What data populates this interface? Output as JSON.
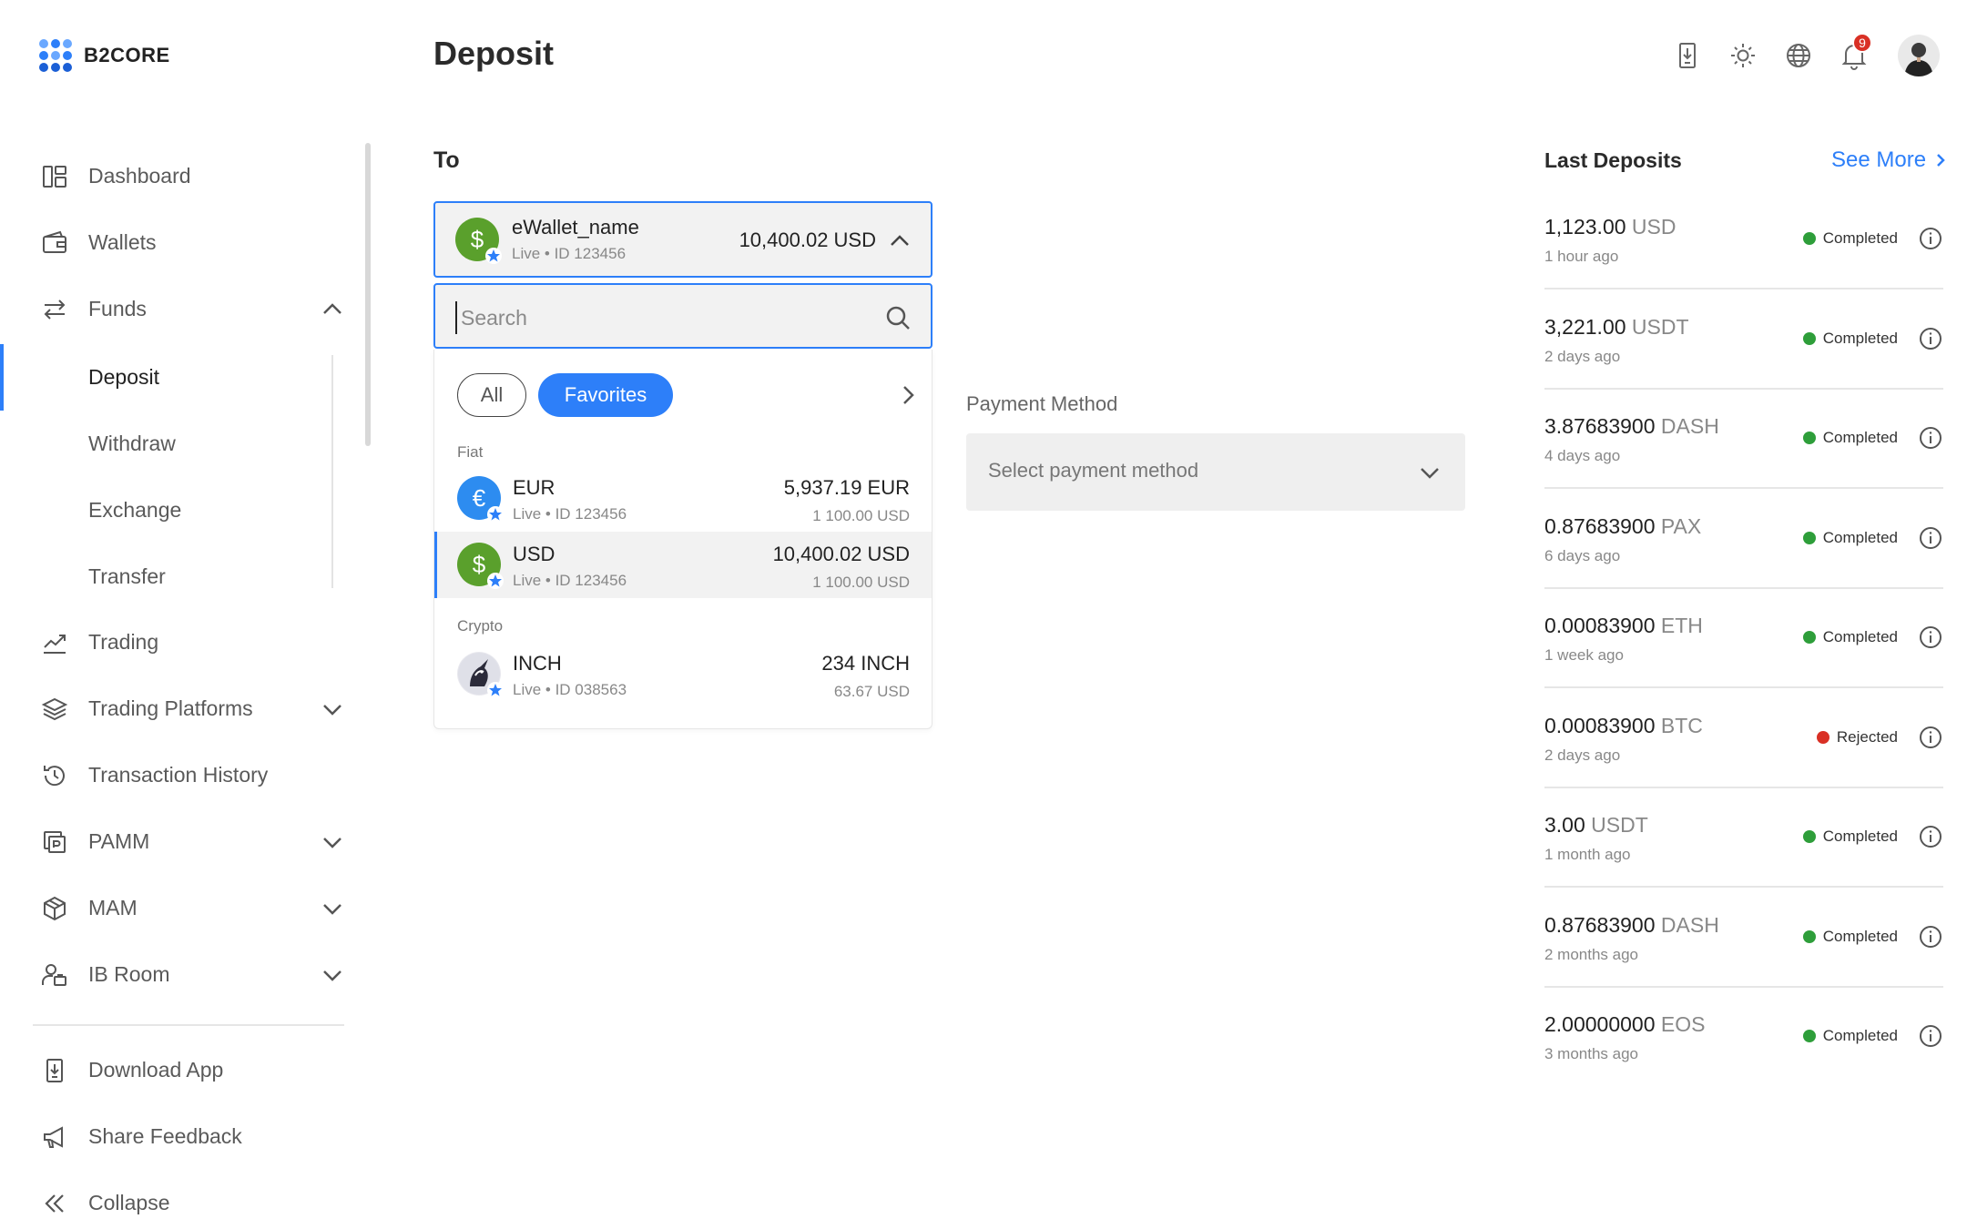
{
  "app": {
    "logo_text": "B2CORE"
  },
  "header": {
    "title": "Deposit",
    "notification_count": "9"
  },
  "sidebar": {
    "items": [
      {
        "label": "Dashboard",
        "icon": "dashboard-icon"
      },
      {
        "label": "Wallets",
        "icon": "wallet-icon"
      },
      {
        "label": "Funds",
        "icon": "transfer-arrows-icon",
        "expanded": true
      },
      {
        "label": "Deposit",
        "sub": true,
        "active": true
      },
      {
        "label": "Withdraw",
        "sub": true
      },
      {
        "label": "Exchange",
        "sub": true
      },
      {
        "label": "Transfer",
        "sub": true
      },
      {
        "label": "Trading",
        "icon": "chart-line-icon"
      },
      {
        "label": "Trading Platforms",
        "icon": "layers-icon"
      },
      {
        "label": "Transaction History",
        "icon": "history-icon"
      },
      {
        "label": "PAMM",
        "icon": "pamm-icon"
      },
      {
        "label": "MAM",
        "icon": "cube-icon"
      },
      {
        "label": "IB Room",
        "icon": "users-icon"
      }
    ],
    "footer": [
      {
        "label": "Download App",
        "icon": "download-app-icon"
      },
      {
        "label": "Share Feedback",
        "icon": "megaphone-icon"
      },
      {
        "label": "Collapse",
        "icon": "collapse-icon"
      }
    ]
  },
  "to_section": {
    "title": "To",
    "selected_wallet": {
      "name": "eWallet_name",
      "meta": "Live • ID 123456",
      "amount": "10,400.02 USD"
    },
    "search_placeholder": "Search",
    "filters": {
      "all": "All",
      "favorites": "Favorites",
      "active": "favorites"
    },
    "groups": [
      {
        "label": "Fiat",
        "accounts": [
          {
            "name": "EUR",
            "meta": "Live • ID 123456",
            "amount": "5,937.19 EUR",
            "sub_amount": "1 100.00 USD",
            "symbol": "€",
            "color": "#2d8cf0",
            "selected": false
          },
          {
            "name": "USD",
            "meta": "Live • ID 123456",
            "amount": "10,400.02 USD",
            "sub_amount": "1 100.00 USD",
            "symbol": "$",
            "color": "#5aa02c",
            "selected": true
          }
        ]
      },
      {
        "label": "Crypto",
        "accounts": [
          {
            "name": "INCH",
            "meta": "Live • ID 038563",
            "amount": "234 INCH",
            "sub_amount": "63.67 USD",
            "symbol": "",
            "color": "#e8e8ee",
            "selected": false
          }
        ]
      }
    ]
  },
  "payment_method": {
    "label": "Payment Method",
    "placeholder": "Select payment method"
  },
  "last_deposits": {
    "title": "Last Deposits",
    "see_more": "See More",
    "items": [
      {
        "value": "1,123.00",
        "currency": "USD",
        "time": "1 hour ago",
        "status": "Completed"
      },
      {
        "value": "3,221.00",
        "currency": "USDT",
        "time": "2 days ago",
        "status": "Completed"
      },
      {
        "value": "3.87683900",
        "currency": "DASH",
        "time": "4 days ago",
        "status": "Completed"
      },
      {
        "value": "0.87683900",
        "currency": "PAX",
        "time": "6 days ago",
        "status": "Completed"
      },
      {
        "value": "0.00083900",
        "currency": "ETH",
        "time": "1 week ago",
        "status": "Completed"
      },
      {
        "value": "0.00083900",
        "currency": "BTC",
        "time": "2 days ago",
        "status": "Rejected"
      },
      {
        "value": "3.00",
        "currency": "USDT",
        "time": "1 month ago",
        "status": "Completed"
      },
      {
        "value": "0.87683900",
        "currency": "DASH",
        "time": "2 months ago",
        "status": "Completed"
      },
      {
        "value": "2.00000000",
        "currency": "EOS",
        "time": "3 months ago",
        "status": "Completed"
      }
    ]
  },
  "colors": {
    "accent": "#2d7ff9",
    "completed": "#2e9e3a",
    "rejected": "#d93025",
    "usd_coin": "#5aa02c",
    "eur_coin": "#2d8cf0"
  }
}
